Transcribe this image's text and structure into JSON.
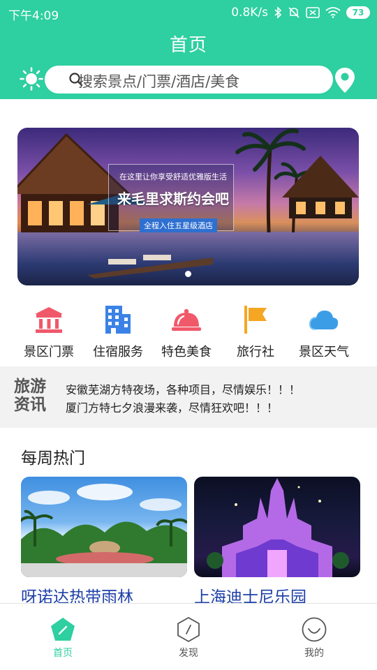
{
  "status_bar": {
    "time": "下午4:09",
    "network_speed": "0.8K/s",
    "battery": "73"
  },
  "header": {
    "title": "首页"
  },
  "search": {
    "placeholder": "搜索景点/门票/酒店/美食"
  },
  "banner": {
    "line1": "在这里让你享受舒适优雅版生活",
    "line2": "来毛里求斯约会吧",
    "line3": "全程入住五星级酒店"
  },
  "categories": [
    {
      "label": "景区门票",
      "icon": "ticket-gate-icon",
      "color": "#f0596a"
    },
    {
      "label": "住宿服务",
      "icon": "building-icon",
      "color": "#3b82e6"
    },
    {
      "label": "特色美食",
      "icon": "food-cloche-icon",
      "color": "#f0596a"
    },
    {
      "label": "旅行社",
      "icon": "flag-icon",
      "color": "#f5a623"
    },
    {
      "label": "景区天气",
      "icon": "cloud-icon",
      "color": "#3b9de6"
    }
  ],
  "news": {
    "logo": "旅游资讯",
    "items": [
      "安徽芜湖方特夜场，各种项目，尽情娱乐！！！",
      "厦门方特七夕浪漫来袭，尽情狂欢吧！！！"
    ]
  },
  "weekly_hot": {
    "title": "每周热门",
    "cards": [
      {
        "title": "呀诺达热带雨林"
      },
      {
        "title": "上海迪士尼乐园"
      }
    ]
  },
  "bottom_nav": {
    "items": [
      {
        "label": "首页",
        "icon": "home-pentagon-icon",
        "active": true
      },
      {
        "label": "发现",
        "icon": "compass-icon",
        "active": false
      },
      {
        "label": "我的",
        "icon": "smile-icon",
        "active": false
      }
    ]
  },
  "colors": {
    "brand": "#2ecfa0",
    "card_title": "#1d3fa8",
    "nav_inactive": "#555555"
  }
}
